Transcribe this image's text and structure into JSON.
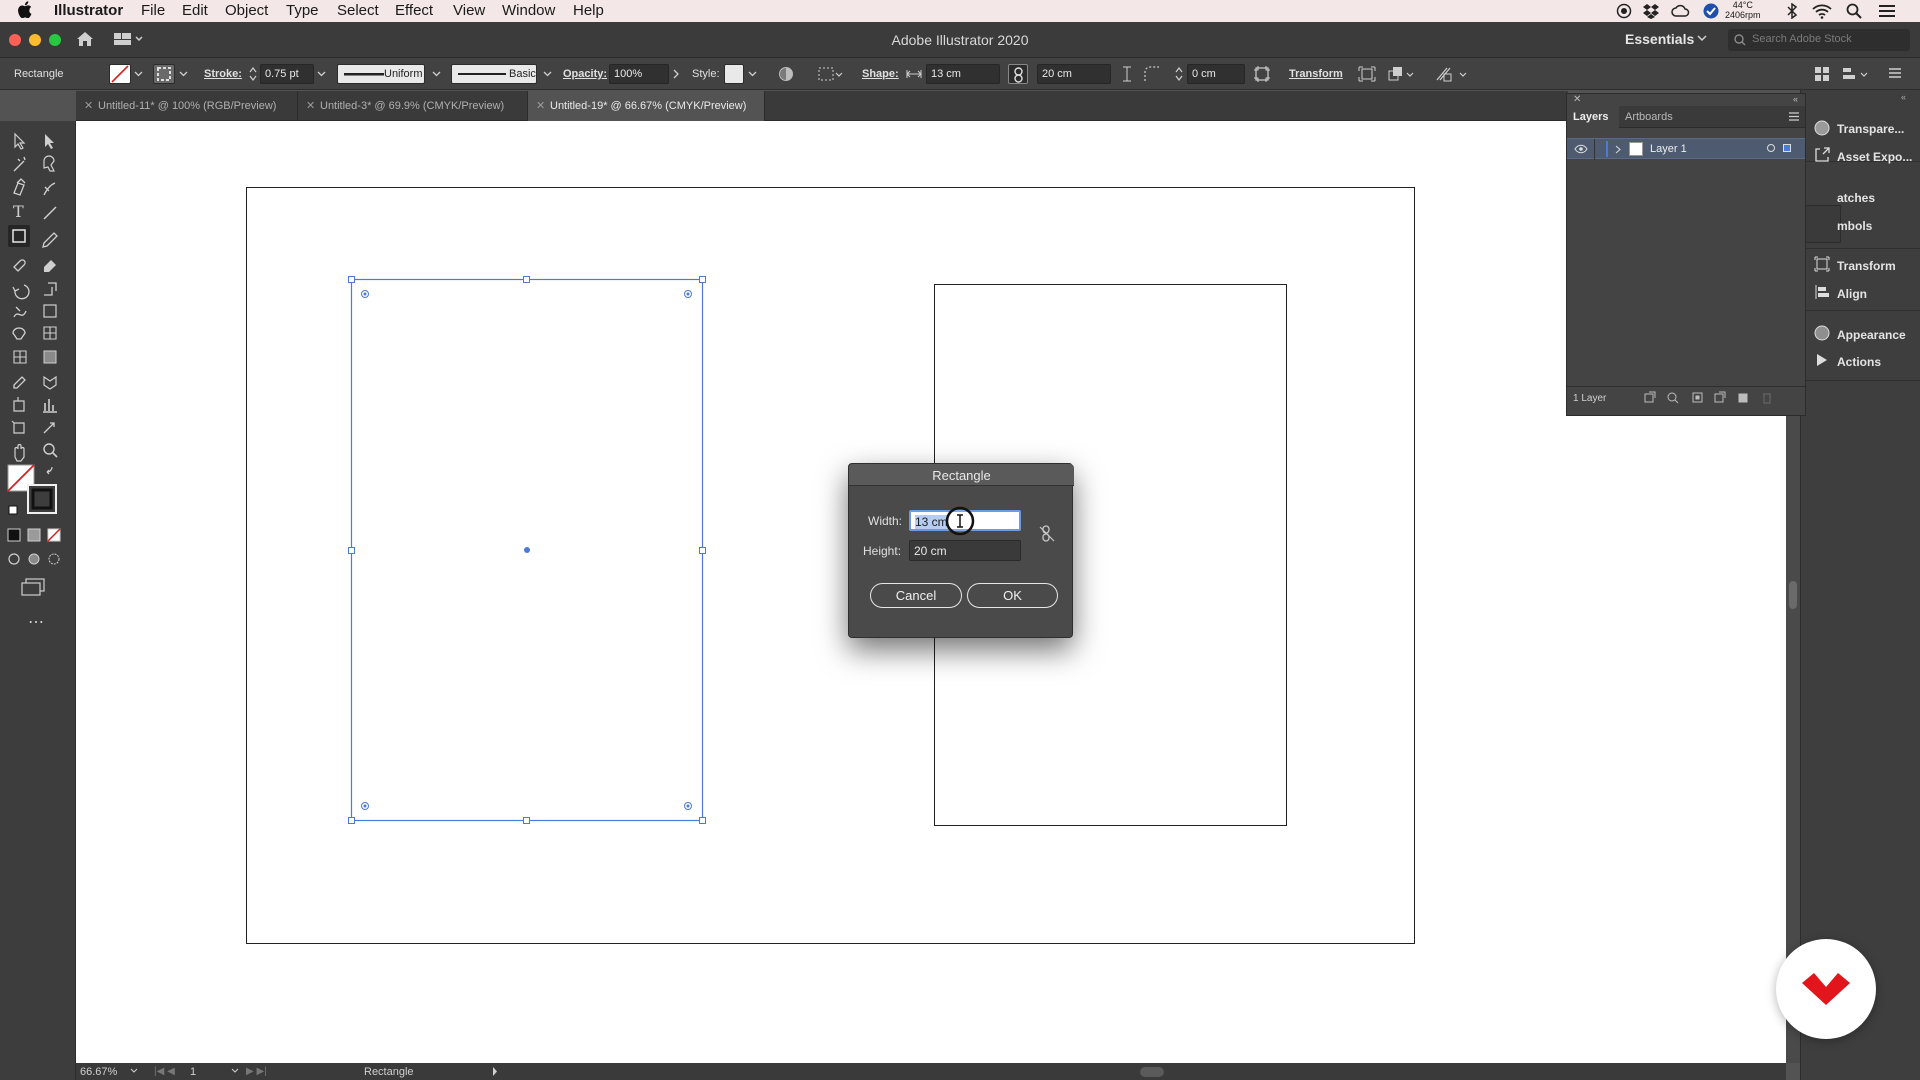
{
  "menubar": {
    "app_name": "Illustrator",
    "items": [
      "File",
      "Edit",
      "Object",
      "Type",
      "Select",
      "Effect",
      "View",
      "Window",
      "Help"
    ],
    "cpu_temp": "44°C",
    "fan_rpm": "2406rpm"
  },
  "window": {
    "title": "Adobe Illustrator 2020",
    "workspace": "Essentials",
    "search_placeholder": "Search Adobe Stock"
  },
  "controlbar": {
    "selection_type": "Rectangle",
    "stroke_label": "Stroke:",
    "stroke_value": "0.75 pt",
    "stroke_profile": "Uniform",
    "brush": "Basic",
    "opacity_label": "Opacity:",
    "opacity_value": "100%",
    "style_label": "Style:",
    "shape_label": "Shape:",
    "shape_width": "13 cm",
    "shape_height": "20 cm",
    "corner_radius": "0 cm",
    "transform_label": "Transform"
  },
  "tabs": [
    {
      "label": "Untitled-11* @ 100% (RGB/Preview)",
      "active": false
    },
    {
      "label": "Untitled-3* @ 69.9% (CMYK/Preview)",
      "active": false
    },
    {
      "label": "Untitled-19* @ 66.67% (CMYK/Preview)",
      "active": true
    }
  ],
  "layers_panel": {
    "tab_layers": "Layers",
    "tab_artboards": "Artboards",
    "layer_name": "Layer 1",
    "footer_count": "1 Layer"
  },
  "right_panel": {
    "items": [
      "Transpare...",
      "Asset Expo...",
      "atches",
      "mbols",
      "Transform",
      "Align",
      "Appearance",
      "Actions"
    ]
  },
  "dialog": {
    "title": "Rectangle",
    "width_label": "Width:",
    "width_value": "13 cm",
    "height_label": "Height:",
    "height_value": "20 cm",
    "cancel_label": "Cancel",
    "ok_label": "OK"
  },
  "statusbar": {
    "zoom": "66.67%",
    "artboard_number": "1",
    "tool_name": "Rectangle"
  },
  "colors": {
    "selection": "#4a7bd8",
    "fill_none_slash": "#d42020",
    "watermark_red": "#e1151b"
  }
}
